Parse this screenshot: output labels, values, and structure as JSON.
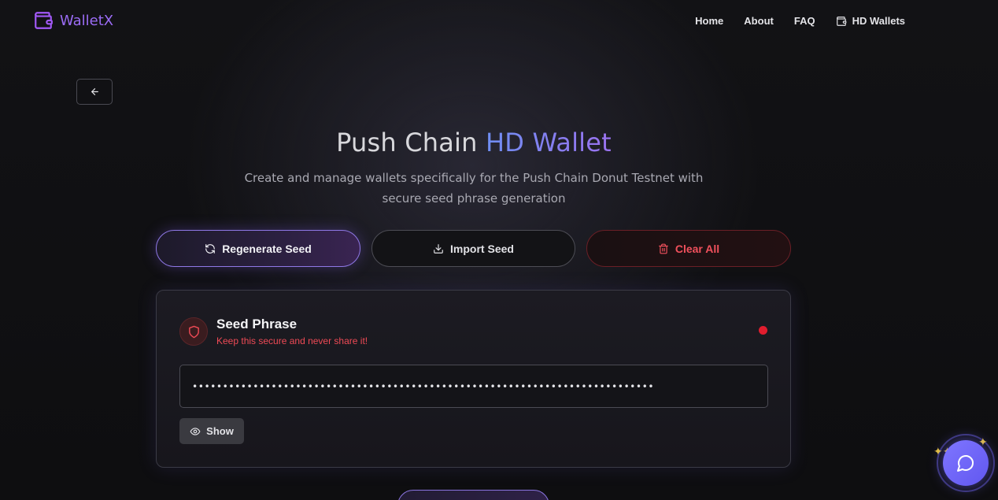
{
  "brand": {
    "name": "WalletX",
    "icon": "wallet-icon"
  },
  "nav": {
    "links": [
      {
        "label": "Home"
      },
      {
        "label": "About"
      },
      {
        "label": "FAQ"
      },
      {
        "label": "HD Wallets",
        "icon": "wallet-icon"
      }
    ]
  },
  "back": {
    "icon": "arrow-left-icon"
  },
  "hero": {
    "title_plain": "Push Chain ",
    "title_accent": "HD Wallet",
    "subtitle": "Create and manage wallets specifically for the Push Chain Donut Testnet with secure seed phrase generation"
  },
  "actions": {
    "regenerate": {
      "label": "Regenerate Seed",
      "icon": "refresh-icon"
    },
    "import": {
      "label": "Import Seed",
      "icon": "download-icon"
    },
    "clear": {
      "label": "Clear All",
      "icon": "trash-icon"
    }
  },
  "seed_card": {
    "title": "Seed Phrase",
    "warning": "Keep this secure and never share it!",
    "masked_value": "••••••••••••••••••••••••••••••••••••••••••••••••••••••••••••••••••••••••••••",
    "show_label": "Show",
    "show_icon": "eye-icon",
    "status_color": "#e11d2e"
  },
  "chat": {
    "icon": "chat-bubble-icon"
  },
  "colors": {
    "accent_purple": "#9b6cf5",
    "accent_blue": "#6f8ef2",
    "danger": "#ef4a55",
    "chat": "#6f66f8"
  }
}
